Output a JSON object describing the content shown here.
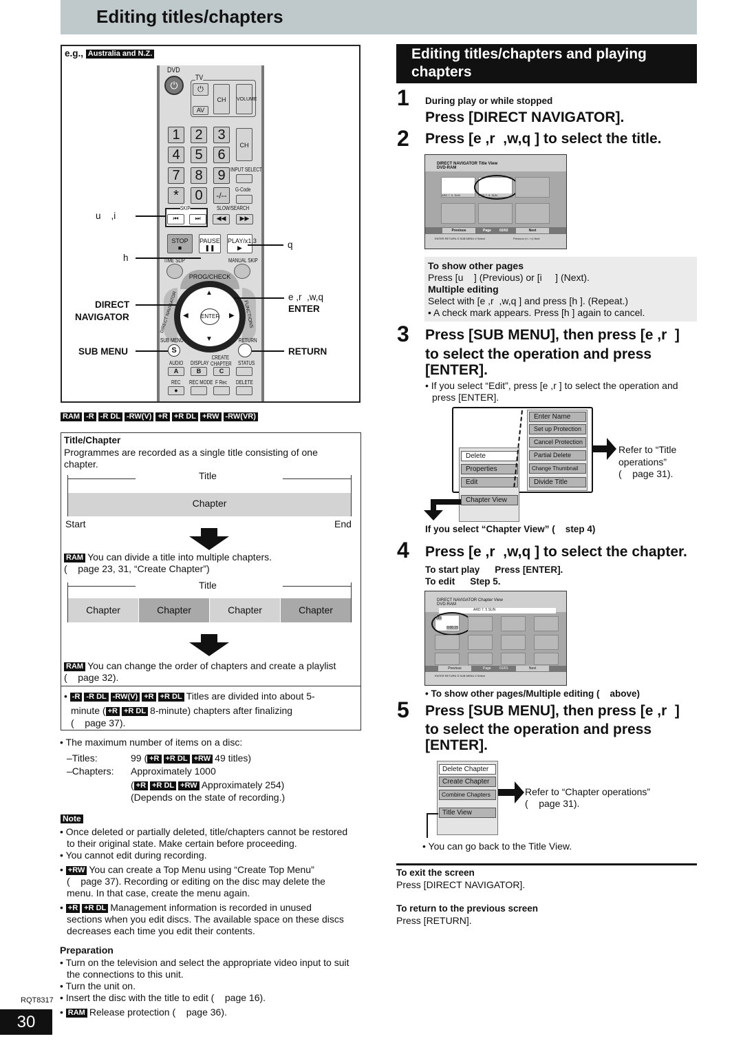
{
  "header": {
    "title": "Editing titles/chapters"
  },
  "left": {
    "eg_label": "e.g.,",
    "eg_region": "Australia and N.Z.",
    "remote": {
      "dvd": "DVD",
      "tv": "TV",
      "ch": "CH",
      "volume": "VOLUME",
      "av": "AV",
      "digits": [
        "1",
        "2",
        "3",
        "4",
        "5",
        "6",
        "7",
        "8",
        "9",
        "*",
        "0",
        "-/--"
      ],
      "input_select": "INPUT SELECT",
      "g_code": "G-Code",
      "skip": "SKIP",
      "slow_search": "SLOW/SEARCH",
      "stop": "STOP",
      "pause": "PAUSE",
      "play": "PLAY/x1.3",
      "time_slip": "TIME SLIP",
      "manual_skip": "MANUAL SKIP",
      "prog_check": "PROG/CHECK",
      "direct_navigator": "DIRECT NAVIGATOR",
      "functions": "FUNCTIONS",
      "enter": "ENTER",
      "sub_menu": "SUB MENU",
      "s": "S",
      "return": "RETURN",
      "audio": "AUDIO",
      "display": "DISPLAY",
      "create_chapter": "CREATE CHAPTER",
      "status": "STATUS",
      "a": "A",
      "b": "B",
      "c": "C",
      "rec": "REC",
      "rec_mode": "REC MODE",
      "f_rec": "F Rec",
      "delete": "DELETE"
    },
    "callouts": {
      "skip": "u    ,i",
      "pause": "h",
      "play": "q",
      "arrows": "e ,r  ,w,q",
      "enter": "ENTER",
      "direct": "DIRECT",
      "navigator": "NAVIGATOR",
      "sub_menu": "SUB MENU",
      "return": "RETURN"
    },
    "disc_badges": [
      "RAM",
      "-R",
      "-R DL",
      "-RW(V)",
      "+R",
      "+R DL",
      "+RW",
      "-RW(VR)"
    ],
    "title_chapter": {
      "heading": "Title/Chapter",
      "intro_1": "Programmes are recorded as a single title consisting of one",
      "intro_2": "chapter.",
      "title": "Title",
      "chapter": "Chapter",
      "start": "Start",
      "end": "End",
      "ram": "RAM",
      "divide_1": "You can divide a title into multiple chapters.",
      "divide_2": "(    page 23, 31, “Create Chapter”)",
      "chapters": [
        "Chapter",
        "Chapter",
        "Chapter",
        "Chapter"
      ],
      "order_1": "You can change the order of chapters and create a playlist",
      "order_2": "(    page 32).",
      "fin_badges": [
        "-R",
        "-R DL",
        "-RW(V)",
        "+R",
        "+R DL"
      ],
      "fin_1": "Titles are divided into about 5-",
      "fin_2a": "minute (",
      "fin_badges2": [
        "+R",
        "+R DL"
      ],
      "fin_2b": "8-minute) chapters after finalizing",
      "fin_3": "(    page 37)."
    },
    "max": {
      "intro": "The maximum number of items on a disc:",
      "titles_label": "–Titles:",
      "titles_a": "99 (",
      "plus_badges": [
        "+R",
        "+R DL",
        "+RW"
      ],
      "titles_b": "49 titles)",
      "chapters_label": "–Chapters:",
      "chapters_val": "Approximately 1000",
      "chapters_b_open": "(",
      "chapters_b": "Approximately 254)",
      "depends": "(Depends on the state of recording.)"
    },
    "note": {
      "label": "Note",
      "items": [
        "Once deleted or partially deleted, title/chapters cannot be restored",
        "to their original state. Make certain before proceeding.",
        "You cannot edit during recording.",
        "You can create a Top Menu using “Create Top Menu”",
        "(    page 37). Recording or editing on the disc may delete the",
        "menu. In that case, create the menu again.",
        "Management information is recorded in unused",
        "sections when you edit discs. The available space on these discs",
        "decreases each time you edit their contents."
      ],
      "badge_rw": "+RW",
      "badge_r": "+R",
      "badge_rdl": "+R DL"
    },
    "preparation": {
      "heading": "Preparation",
      "items": [
        "Turn on the television and select the appropriate video input to suit",
        "the connections to this unit.",
        "Turn the unit on.",
        "Insert the disc with the title to edit (    page 16).",
        "Release protection (    page 36)."
      ],
      "ram": "RAM"
    }
  },
  "footer": {
    "code": "RQT8317",
    "page": "30"
  },
  "right": {
    "section_title_1": "Editing titles/chapters and playing",
    "section_title_2": "chapters",
    "step1": {
      "num": "1",
      "sub": "During play or while stopped",
      "text": "Press [DIRECT NAVIGATOR]."
    },
    "step2": {
      "num": "2",
      "text": "Press [e ,r  ,w,q ] to select the title."
    },
    "screen1": {
      "header": "DIRECT NAVIGATOR   Title View",
      "disc": "DVD-RAM",
      "thumb_label": "ARD    7. 5. SUN",
      "prev": "Previous",
      "page": "Page",
      "page_val": "02/02",
      "next": "Next",
      "footer": "ENTER  RETURN   S SUB MENU  II Select",
      "footer_r": "Previous  |<< >>|  Next"
    },
    "info": {
      "h1": "To show other pages",
      "l1": "Press [u    ] (Previous) or [i     ] (Next).",
      "h2": "Multiple editing",
      "l2": "Select with [e ,r  ,w,q ] and press [h ]. (Repeat.)",
      "l3": "A check mark appears. Press [h ] again to cancel."
    },
    "step3": {
      "num": "3",
      "l1": "Press [SUB MENU], then press [e ,r  ]",
      "l2": "to select the operation and press",
      "l3": "[ENTER].",
      "b1": "If you select “Edit”, press [e ,r  ] to select the operation and",
      "b2": "press [ENTER]."
    },
    "menu1": {
      "left": [
        "Delete",
        "Properties",
        "Edit",
        "Chapter View"
      ],
      "right": [
        "Enter Name",
        "Set up Protection",
        "Cancel Protection",
        "Partial Delete",
        "Change Thumbnail",
        "Divide Title"
      ],
      "refer_1": "Refer to “Title",
      "refer_2": "operations”",
      "refer_3": "(    page 31).",
      "if_select": "If you select “Chapter View” (    step 4)"
    },
    "step4": {
      "num": "4",
      "text": "Press [e ,r  ,w,q ] to select the chapter.",
      "start_label": "To start play",
      "start_val": "Press [ENTER].",
      "edit_label": "To edit",
      "edit_val": "Step 5."
    },
    "screen2": {
      "header": "DIRECT NAVIGATOR   Chapter View",
      "disc": "DVD-RAM",
      "bar": "ARD   7. 5 SUN",
      "num": "001",
      "time": "0:00.15",
      "prev": "Previous",
      "page": "Page",
      "page_val": "01/01",
      "next": "Next",
      "footer": "ENTER  RETURN   S SUB MENU  II Select"
    },
    "other": "To show other pages/Multiple editing (    above)",
    "step5": {
      "num": "5",
      "l1": "Press [SUB MENU], then press [e ,r  ]",
      "l2": "to select the operation and press",
      "l3": "[ENTER]."
    },
    "menu2": {
      "items": [
        "Delete Chapter",
        "Create Chapter",
        "Combine Chapters",
        "Title View"
      ],
      "refer_1": "Refer to “Chapter operations”",
      "refer_2": "(    page 31).",
      "back": "You can go back to the Title View."
    },
    "exit": {
      "h": "To exit the screen",
      "t": "Press [DIRECT NAVIGATOR]."
    },
    "back": {
      "h": "To return to the previous screen",
      "t": "Press [RETURN]."
    }
  },
  "colors": {
    "header_bg": "#bfc8cb",
    "section_bg": "#111111",
    "info_bg": "#ebebeb"
  }
}
